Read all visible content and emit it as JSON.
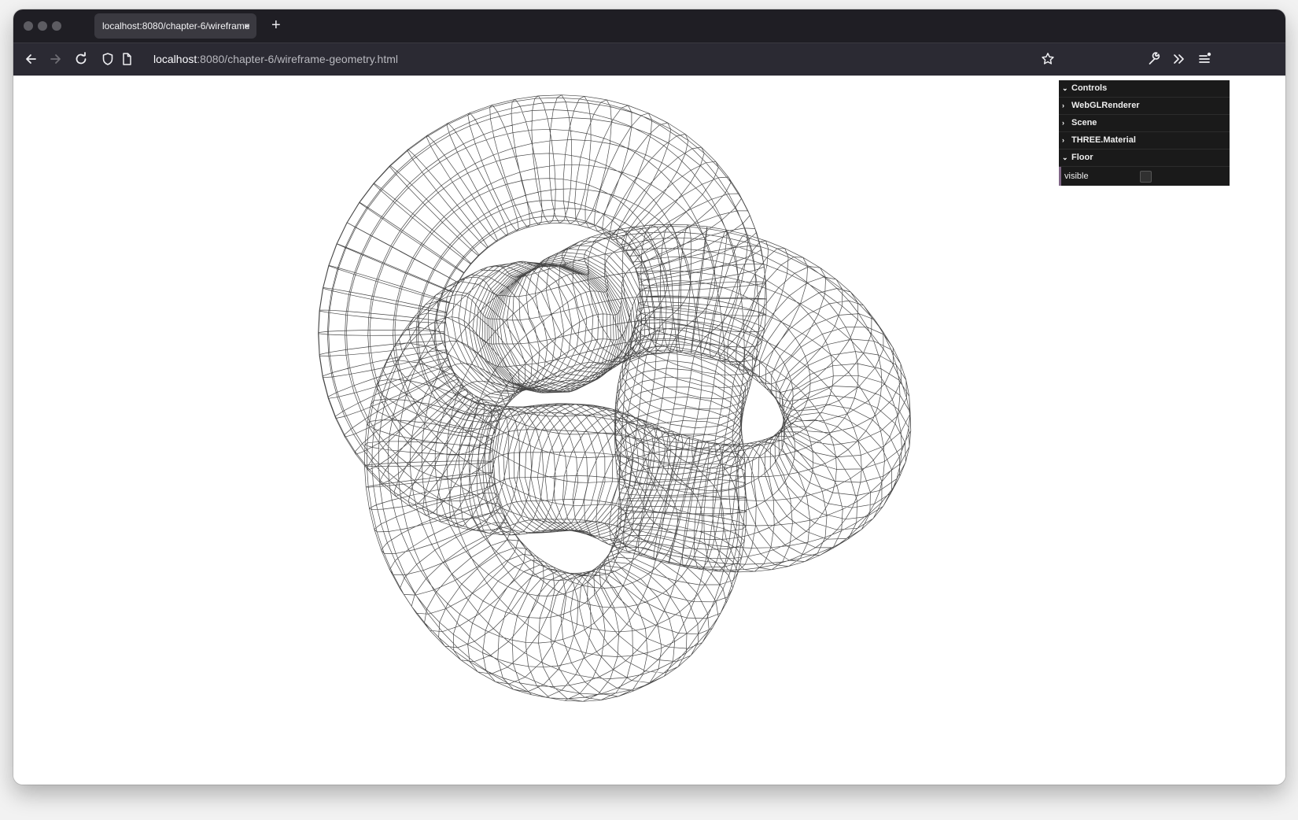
{
  "browser": {
    "tab_title": "localhost:8080/chapter-6/wireframe",
    "tab_close": "×",
    "new_tab": "+",
    "url_host": "localhost",
    "url_path": ":8080/chapter-6/wireframe-geometry.html"
  },
  "gui": {
    "controls": "Controls",
    "folders": [
      "WebGLRenderer",
      "Scene",
      "THREE.Material",
      "Floor"
    ],
    "visible_label": "visible",
    "visible_checked": false
  },
  "colors": {
    "chrome_dark": "#1f1e24",
    "toolbar": "#2b2a33",
    "wire": "#1a1a1a",
    "gui_bg": "#1a1a1a"
  }
}
